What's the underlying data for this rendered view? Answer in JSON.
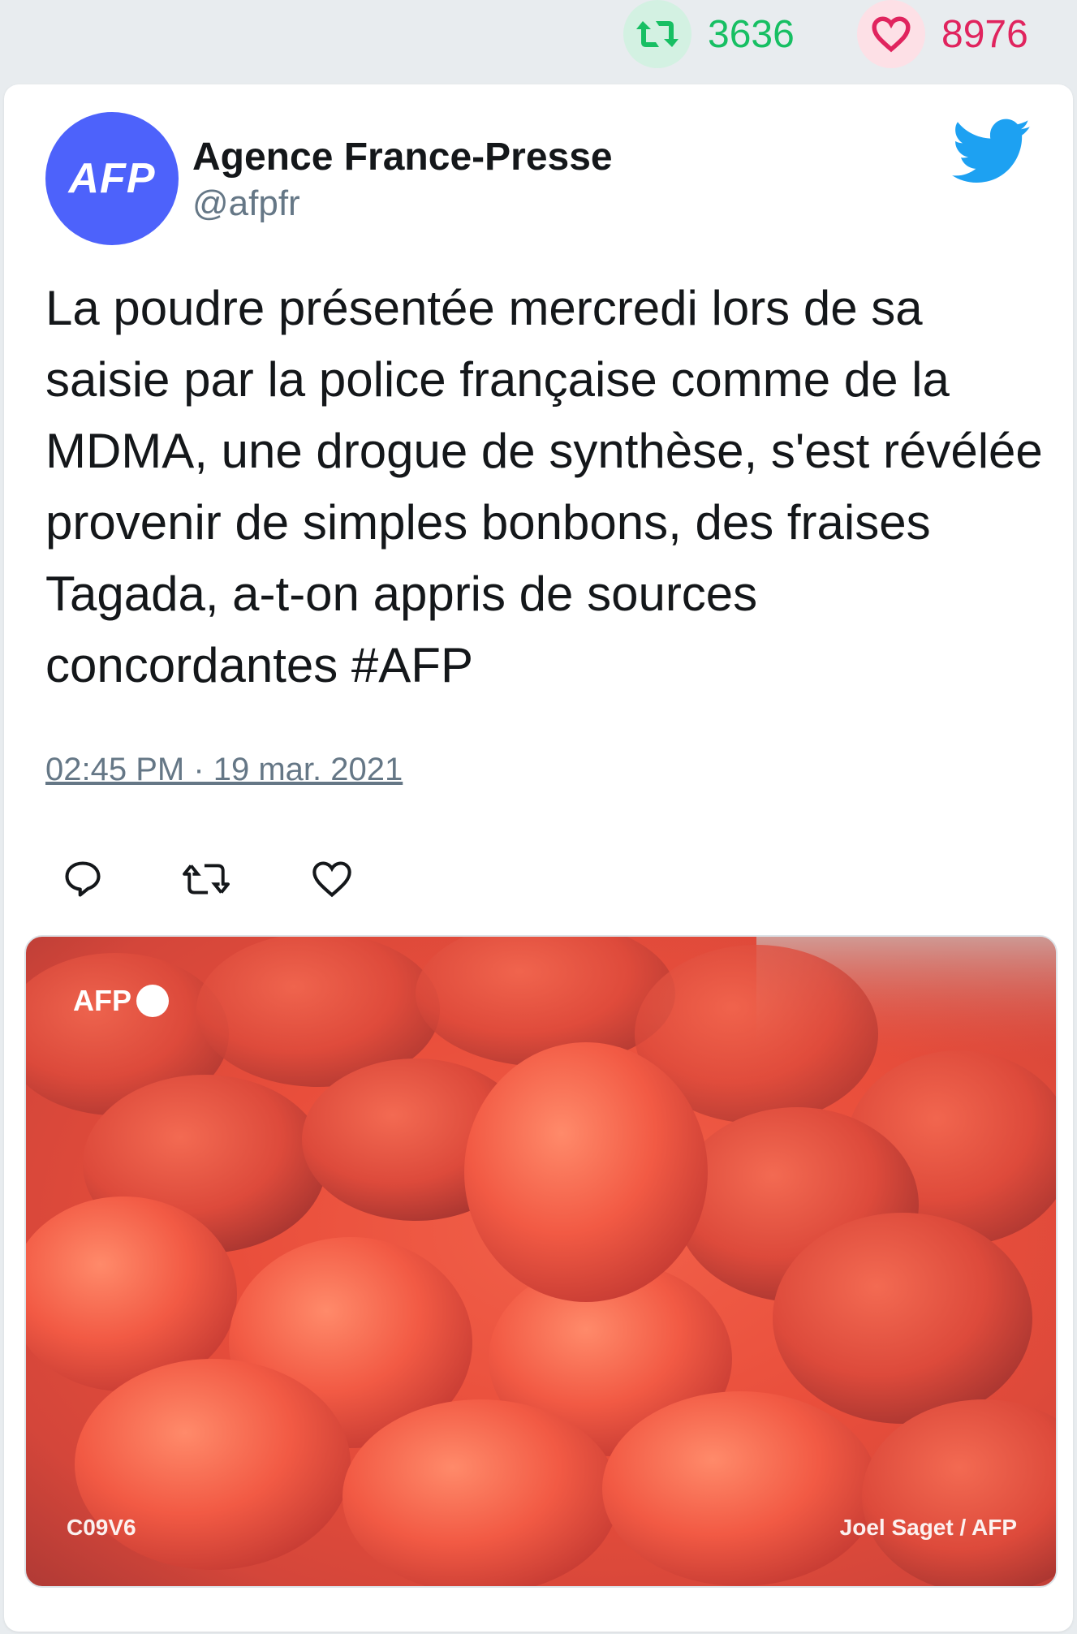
{
  "stats": {
    "retweet_icon": "retweet-icon",
    "retweet_count": "3636",
    "like_icon": "heart-icon",
    "like_count": "8976",
    "retweet_color": "#17bf63",
    "like_color": "#e0245e"
  },
  "author": {
    "avatar_text": "AFP",
    "avatar_color": "#4d62fb",
    "name": "Agence France-Presse",
    "handle": "@afpfr",
    "platform_icon": "twitter-bird-icon",
    "platform_color": "#1da1f2"
  },
  "tweet": {
    "text": "La poudre présentée mercredi lors de sa saisie par la police française comme de la MDMA, une drogue de synthèse, s'est révélée provenir de simples bonbons, des fraises Tagada, a-t-on appris de sources concordantes #AFP",
    "timestamp": "02:45 PM · 19 mar. 2021"
  },
  "actions": [
    {
      "icon": "reply-icon"
    },
    {
      "icon": "retweet-icon"
    },
    {
      "icon": "like-icon"
    }
  ],
  "media": {
    "description_icon": "strawberry-candies-photo",
    "logo_text": "AFP",
    "code": "C09V6",
    "credit": "Joel Saget / AFP"
  }
}
